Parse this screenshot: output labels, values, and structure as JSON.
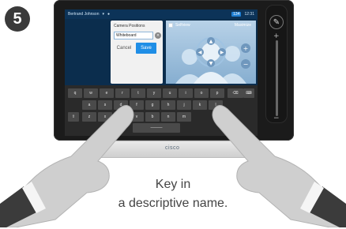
{
  "step_number": "5",
  "status_bar": {
    "user": "Bertrand Johnson",
    "time": "12:31",
    "badge": "134"
  },
  "dialog": {
    "title": "Camera Positions",
    "input_value": "Whiteboard",
    "cancel_label": "Cancel",
    "save_label": "Save"
  },
  "camera_panel": {
    "left_label": "Selfview",
    "right_label": "Maximize"
  },
  "keyboard": {
    "row1": [
      "q",
      "w",
      "e",
      "r",
      "t",
      "y",
      "u",
      "i",
      "o",
      "p"
    ],
    "row2": [
      "a",
      "s",
      "d",
      "f",
      "g",
      "h",
      "j",
      "k",
      "l"
    ],
    "row3": [
      "z",
      "x",
      "c",
      "v",
      "b",
      "n",
      "m"
    ],
    "space_label": "———"
  },
  "brand": "cisco",
  "caption": {
    "line1": "Key in",
    "line2": "a descriptive name."
  },
  "colors": {
    "screen_bg": "#0b2d4d",
    "accent": "#1f8ee6",
    "keyboard_bg": "#2a2a2a"
  }
}
